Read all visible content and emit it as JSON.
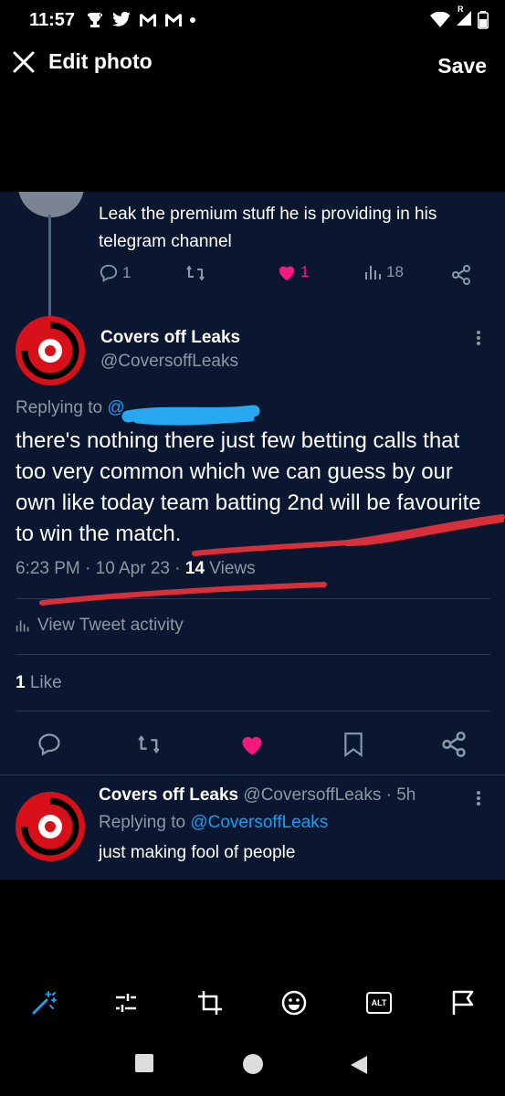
{
  "status_bar": {
    "time": "11:57",
    "icons": [
      "trophy-icon",
      "twitter-icon",
      "gmail-icon",
      "gmail-icon",
      "dot-icon"
    ],
    "right_icons": [
      "wifi-icon",
      "signal-icon",
      "battery-icon"
    ],
    "signal_label": "R"
  },
  "toolbar": {
    "title": "Edit photo",
    "save_label": "Save"
  },
  "photo": {
    "prev_reply": {
      "text": "Leak the premium stuff he is providing in his telegram channel",
      "replies": "1",
      "likes": "1",
      "views": "18"
    },
    "main_tweet": {
      "name": "Covers off Leaks",
      "handle": "@CoversoffLeaks",
      "replying_label": "Replying to",
      "replying_handle": "@",
      "text": "there's nothing there just few betting calls that too very common which we can guess by our own like today team batting 2nd will be favourite to win the match.",
      "time": "6:23 PM · 10 Apr 23 · ",
      "views_count": "14",
      "views_label": "Views",
      "activity_label": "View Tweet activity",
      "likes_count": "1",
      "likes_label": "Like"
    },
    "reply": {
      "name": "Covers off Leaks",
      "handle_time": "@CoversoffLeaks · 5h",
      "replying_label": "Replying to",
      "replying_handle": "@CoversoffLeaks",
      "text": "just making fool of people"
    },
    "colors": {
      "background": "#0b1730",
      "like_pink": "#f91880",
      "link_blue": "#1d9bf0",
      "scribble_red": "#d8303a"
    }
  },
  "edit_tools": [
    "magic-wand-icon",
    "adjust-icon",
    "crop-icon",
    "sticker-icon",
    "alt-text-icon",
    "flag-icon"
  ],
  "edit_tools_alt_label": "ALT",
  "nav": [
    "recent-apps-icon",
    "home-icon",
    "back-icon"
  ]
}
